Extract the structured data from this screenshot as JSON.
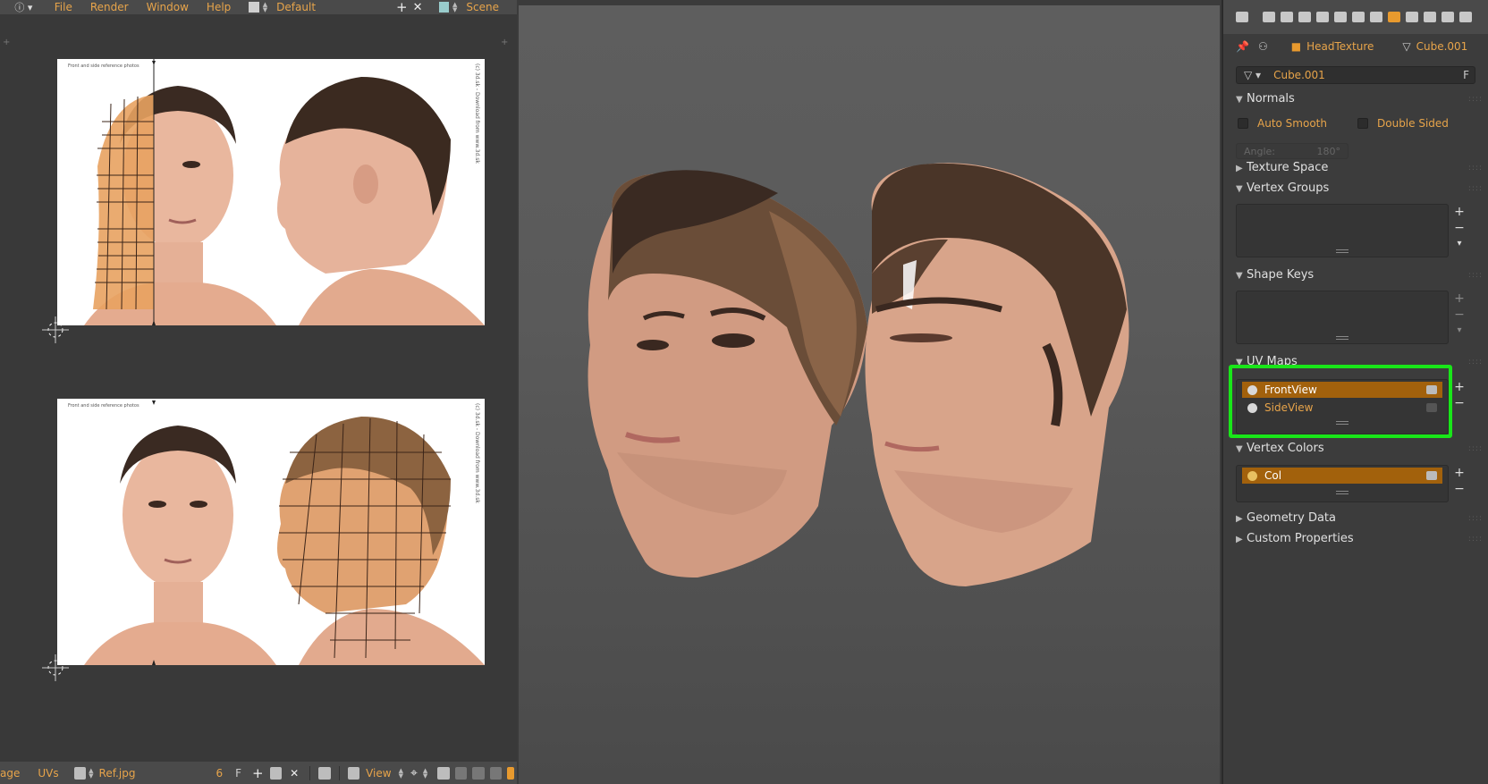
{
  "top_menu": {
    "items": [
      "File",
      "Render",
      "Window",
      "Help"
    ],
    "layout": "Default",
    "scene": "Scene"
  },
  "uv_editor": {
    "footer": {
      "mode_label": "age",
      "uvs_menu": "UVs",
      "image_name": "Ref.jpg",
      "user_count": "6",
      "fake_user": "F",
      "view_menu": "View"
    },
    "images": [
      {
        "caption_top": "Front and side reference photos",
        "side_text": "(c) 3d.sk - Download from www.3d.sk"
      },
      {
        "caption_top": "Front and side reference photos",
        "side_text": "(c) 3d.sk - Download from www.3d.sk"
      }
    ]
  },
  "properties": {
    "breadcrumb": {
      "texture": "HeadTexture",
      "object": "Cube.001"
    },
    "mesh_name": "Cube.001",
    "mesh_fake_user": "F",
    "sections": {
      "normals": "Normals",
      "auto_smooth": "Auto Smooth",
      "double_sided": "Double Sided",
      "angle_label": "Angle:",
      "angle_value": "180°",
      "texture_space": "Texture Space",
      "vertex_groups": "Vertex Groups",
      "shape_keys": "Shape Keys",
      "uv_maps": "UV Maps",
      "vertex_colors": "Vertex Colors",
      "geometry_data": "Geometry Data",
      "custom_properties": "Custom Properties"
    },
    "uv_maps": [
      {
        "name": "FrontView",
        "selected": true
      },
      {
        "name": "SideView",
        "selected": false
      }
    ],
    "vertex_colors": [
      {
        "name": "Col",
        "selected": true
      }
    ]
  },
  "colors": {
    "accent_orange": "#e7a44a",
    "selected_row": "#a2610c",
    "highlight_green": "#19e619"
  }
}
